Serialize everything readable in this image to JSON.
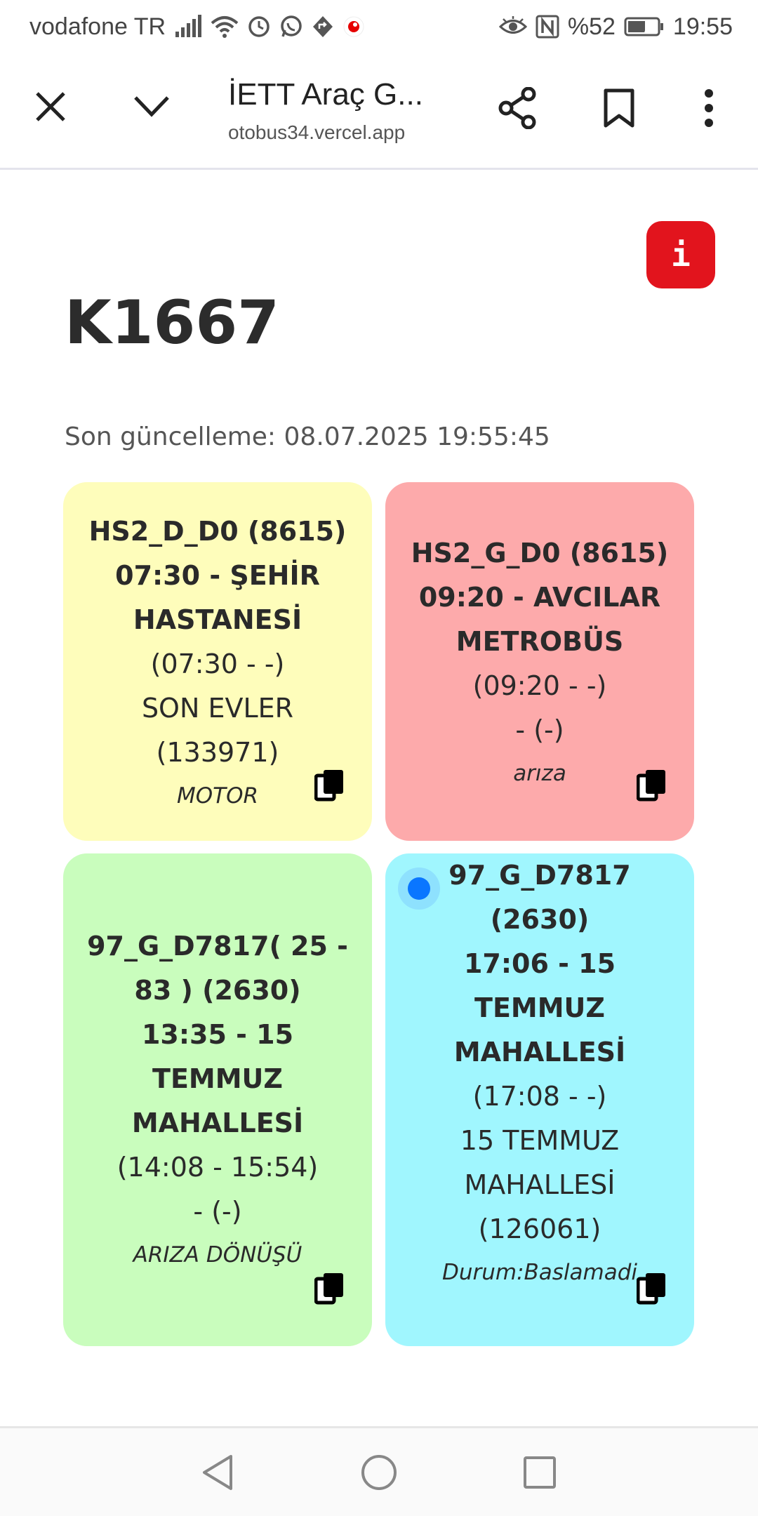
{
  "status_bar": {
    "carrier": "vodafone TR",
    "battery": "%52",
    "time": "19:55"
  },
  "browser": {
    "title": "İETT Araç G...",
    "url": "otobus34.vercel.app"
  },
  "page": {
    "info_label": "i",
    "title": "K1667",
    "last_update": "Son güncelleme: 08.07.2025 19:55:45"
  },
  "cards": [
    {
      "lines": [
        "HS2_D_D0 (8615)",
        "07:30 - ŞEHİR",
        "HASTANESİ",
        "(07:30 - -)",
        "SON EVLER",
        "(133971)"
      ],
      "bold_count": 3,
      "status": "MOTOR",
      "color": "#fefdbb"
    },
    {
      "lines": [
        "HS2_G_D0 (8615)",
        "09:20 - AVCILAR",
        "METROBÜS",
        "(09:20 - -)",
        "- (-)"
      ],
      "bold_count": 3,
      "status": "arıza",
      "color": "#fdaaab"
    },
    {
      "lines": [
        "97_G_D7817( 25 -",
        "83 ) (2630)",
        "13:35 - 15",
        "TEMMUZ",
        "MAHALLESİ",
        "(14:08 - 15:54)",
        "- (-)"
      ],
      "bold_count": 5,
      "status": "ARIZA DÖNÜŞÜ",
      "color": "#c9fdbd"
    },
    {
      "lines": [
        "97_G_D7817",
        "(2630)",
        "17:06 - 15",
        "TEMMUZ",
        "MAHALLESİ",
        "(17:08 - -)",
        "15 TEMMUZ",
        "MAHALLESİ",
        "(126061)"
      ],
      "bold_count": 5,
      "status": "Durum:Baslamadi",
      "color": "#a0f6fe"
    }
  ]
}
